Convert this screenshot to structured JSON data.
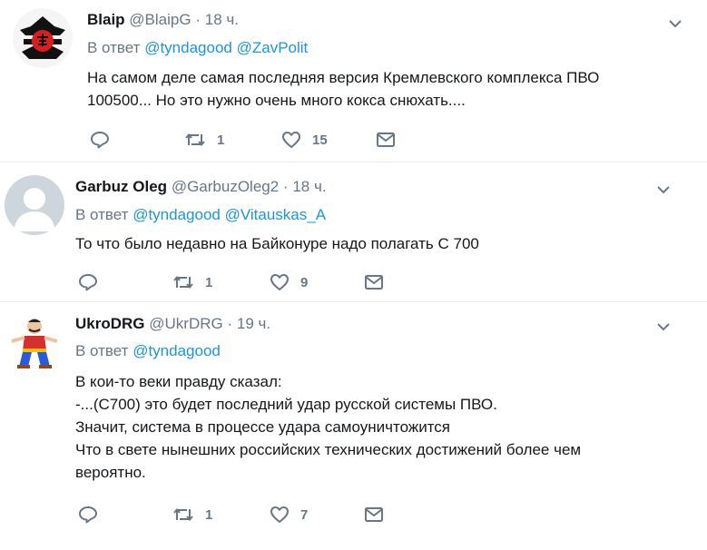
{
  "tweets": [
    {
      "name": "Blaip",
      "handle": "@BlaipG",
      "dot": "·",
      "time": "18 ч.",
      "reply_prefix": "В ответ",
      "mentions": [
        "@tyndagood",
        "@ZavPolit"
      ],
      "lines": [
        "На самом деле самая последняя версия Кремлевского комплекса ПВО",
        "100500... Но это нужно очень много кокса снюхать...."
      ],
      "retweets": "1",
      "likes": "15",
      "avatar_icon": "samurai-logo-avatar"
    },
    {
      "name": "Garbuz Oleg",
      "handle": "@GarbuzOleg2",
      "dot": "·",
      "time": "18 ч.",
      "reply_prefix": "В ответ",
      "mentions": [
        "@tyndagood",
        "@Vitauskas_A"
      ],
      "lines": [
        "То что было недавно на Байконуре надо полагать С 700"
      ],
      "retweets": "1",
      "likes": "9",
      "avatar_icon": "default-avatar"
    },
    {
      "name": "UkroDRG",
      "handle": "@UkrDRG",
      "dot": "·",
      "time": "19 ч.",
      "reply_prefix": "В ответ",
      "mentions": [
        "@tyndagood"
      ],
      "lines": [
        "В кои-то веки правду сказал:",
        "-...(С700) это будет последний удар русской системы ПВО.",
        "Значит, система в процессе удара самоуничтожится",
        "Что в свете нынешних российских технических достижений более чем",
        "вероятно."
      ],
      "retweets": "1",
      "likes": "7",
      "avatar_icon": "cossack-cartoon-avatar"
    }
  ],
  "colors": {
    "text": "#14171a",
    "secondary": "#657786",
    "link": "#1b95e0",
    "divider": "#e6ecf0"
  }
}
